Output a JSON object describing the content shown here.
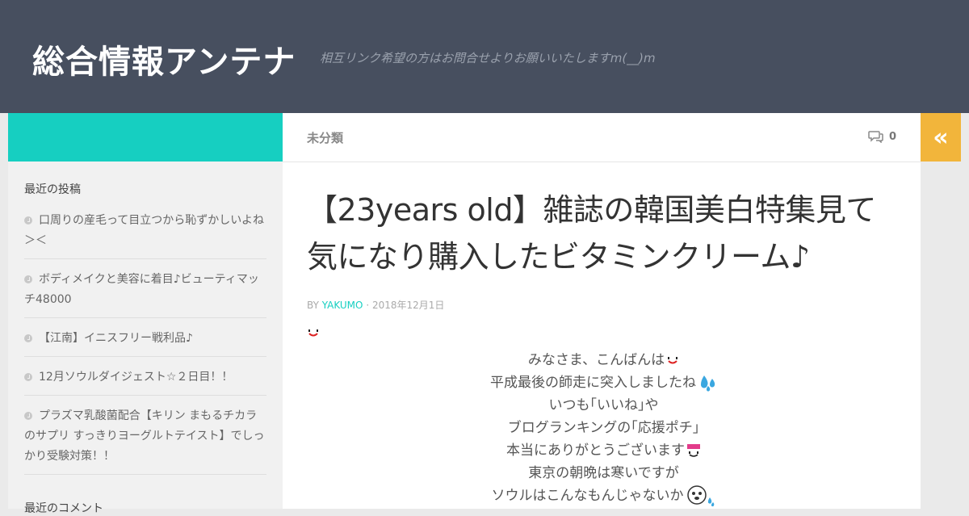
{
  "header": {
    "site_title": "総合情報アンテナ",
    "site_description": "相互リンク希望の方はお問合せよりお願いいたしますm(__)m"
  },
  "topbar": {
    "category": "未分類",
    "comment_count": "0",
    "toggle_icon": "«"
  },
  "sidebar": {
    "recent_posts_title": "最近の投稿",
    "recent_posts": [
      "口周りの産毛って目立つから恥ずかしいよね＞＜",
      "ボディメイクと美容に着目♪ビューティマッチ48000",
      "【江南】イニスフリー戦利品♪",
      "12月ソウルダイジェスト☆２日目！！",
      "プラズマ乳酸菌配合【キリン まもるチカラのサプリ すっきりヨーグルトテイスト】でしっかり受験対策！！"
    ],
    "recent_comments_title": "最近のコメント"
  },
  "post": {
    "title": "【23years old】雑誌の韓国美白特集見て気になり購入したビタミンクリーム♪",
    "byline_prefix": "BY",
    "author": "YAKUMO",
    "date": "· 2018年12月1日",
    "body_lines": [
      "みなさま、こんばんは",
      "平成最後の師走に突入しましたね",
      "いつも｢いいね｣や",
      "ブログランキングの｢応援ポチ｣",
      "本当にありがとうございます",
      "東京の朝晩は寒いですが",
      "ソウルはこんなもんじゃないか"
    ],
    "icons": [
      "smile-emoji-icon",
      "sweat-drop-icon",
      "thank-you-emoji-icon",
      "seal-emoji-icon"
    ]
  },
  "colors": {
    "header_bg": "#474f5f",
    "accent_teal": "#16cfc1",
    "toggle_orange": "#f2b53b",
    "sidebar_bg": "#f1f1f1"
  }
}
